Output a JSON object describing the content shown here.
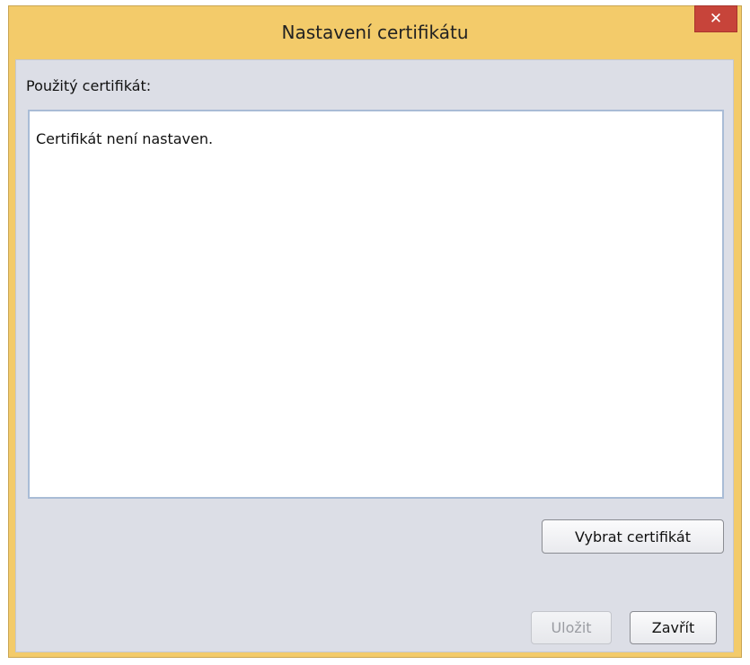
{
  "window": {
    "title": "Nastavení certifikátu",
    "close_glyph": "✕",
    "close_icon": "close-icon"
  },
  "content": {
    "label": "Použitý certifikát:",
    "certificate_text": "Certifikát není nastaven."
  },
  "buttons": {
    "select_certificate": "Vybrat certifikát",
    "save": "Uložit",
    "close": "Zavřít"
  },
  "colors": {
    "titlebar": "#f3cb6a",
    "close_button": "#c7443a",
    "client_background": "#dcdee6",
    "textarea_border": "#a9bcd6"
  }
}
